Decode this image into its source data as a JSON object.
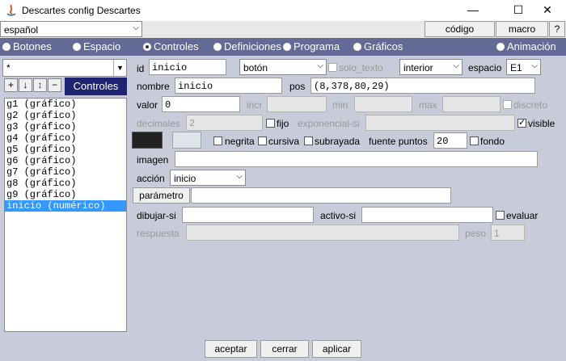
{
  "window": {
    "title": "Descartes config Descartes",
    "minimize": "—",
    "maximize": "☐",
    "close": "✕"
  },
  "langbar": {
    "language": "español",
    "code_button": "código",
    "macro_button": "macro",
    "help_button": "?"
  },
  "tabs": [
    {
      "label": "Botones",
      "selected": false
    },
    {
      "label": "Espacio",
      "selected": false
    },
    {
      "label": "Controles",
      "selected": true
    },
    {
      "label": "Definiciones",
      "selected": false
    },
    {
      "label": "Programa",
      "selected": false
    },
    {
      "label": "Gráficos",
      "selected": false
    },
    {
      "label": "Animación",
      "selected": false
    }
  ],
  "left": {
    "filter_value": "*",
    "add_button": "+",
    "down_button": "↓",
    "updown_button": "↕",
    "remove_button": "−",
    "section_label": "Controles",
    "items": [
      "g1 (gráfico)",
      "g2 (gráfico)",
      "g3 (gráfico)",
      "g4 (gráfico)",
      "g5 (gráfico)",
      "g6 (gráfico)",
      "g7 (gráfico)",
      "g8 (gráfico)",
      "g9 (gráfico)",
      "inicio (numérico)"
    ],
    "selected_index": 9
  },
  "form": {
    "id_label": "id",
    "id_value": "inicio",
    "type_value": "botón",
    "solo_texto_label": "solo_texto",
    "region_value": "interior",
    "espacio_label": "espacio",
    "espacio_value": "E1",
    "nombre_label": "nombre",
    "nombre_value": "inicio",
    "pos_label": "pos",
    "pos_value": "(8,378,80,29)",
    "valor_label": "valor",
    "valor_value": "0",
    "incr_label": "incr",
    "min_label": "min",
    "max_label": "max",
    "discreto_label": "discreto",
    "decimales_label": "decimales",
    "decimales_value": "2",
    "fijo_label": "fijo",
    "exponencial_label": "exponencial-si",
    "visible_label": "visible",
    "negrita_label": "negrita",
    "cursiva_label": "cursiva",
    "subrayada_label": "subrayada",
    "fuente_label": "fuente puntos",
    "fuente_value": "20",
    "fondo_label": "fondo",
    "imagen_label": "imagen",
    "accion_label": "acción",
    "accion_value": "inicio",
    "parametro_button": "parámetro",
    "dibujar_label": "dibujar-si",
    "activo_label": "activo-si",
    "evaluar_label": "evaluar",
    "respuesta_label": "respuesta",
    "peso_label": "peso",
    "peso_value": "1"
  },
  "bottom": {
    "accept": "aceptar",
    "close": "cerrar",
    "apply": "aplicar"
  },
  "colors": {
    "tab_bar": "#636a96",
    "panel": "#c8cbd9",
    "section_label_bg": "#1e2472",
    "selection": "#3399ff",
    "color_swatch_1": "#222222",
    "color_swatch_2": "#dfe3ea"
  }
}
